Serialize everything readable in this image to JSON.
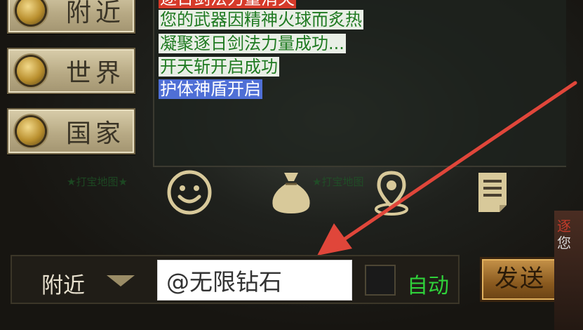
{
  "channels": [
    {
      "label": "附近"
    },
    {
      "label": "世界"
    },
    {
      "label": "国家"
    }
  ],
  "chat": [
    {
      "text": "逐日剑法力量消失",
      "style": "red"
    },
    {
      "text": "您的武器因精神火球而炙热",
      "style": "green"
    },
    {
      "text": "凝聚逐日剑法力量成功...",
      "style": "green"
    },
    {
      "text": "开天斩开启成功",
      "style": "green"
    },
    {
      "text": "护体神盾开启",
      "style": "blue"
    }
  ],
  "toolbar": {
    "ghost_left": "★打宝地图★",
    "ghost_right": "★打宝地图"
  },
  "input_bar": {
    "channel_select": "附近",
    "message_value": "@无限钻石",
    "auto_label": "自动",
    "send_label": "发送"
  },
  "right_edge": {
    "t1": "逐",
    "t2": "您"
  },
  "colors": {
    "arrow": "#e0463a",
    "auto_text": "#2fd13a"
  }
}
